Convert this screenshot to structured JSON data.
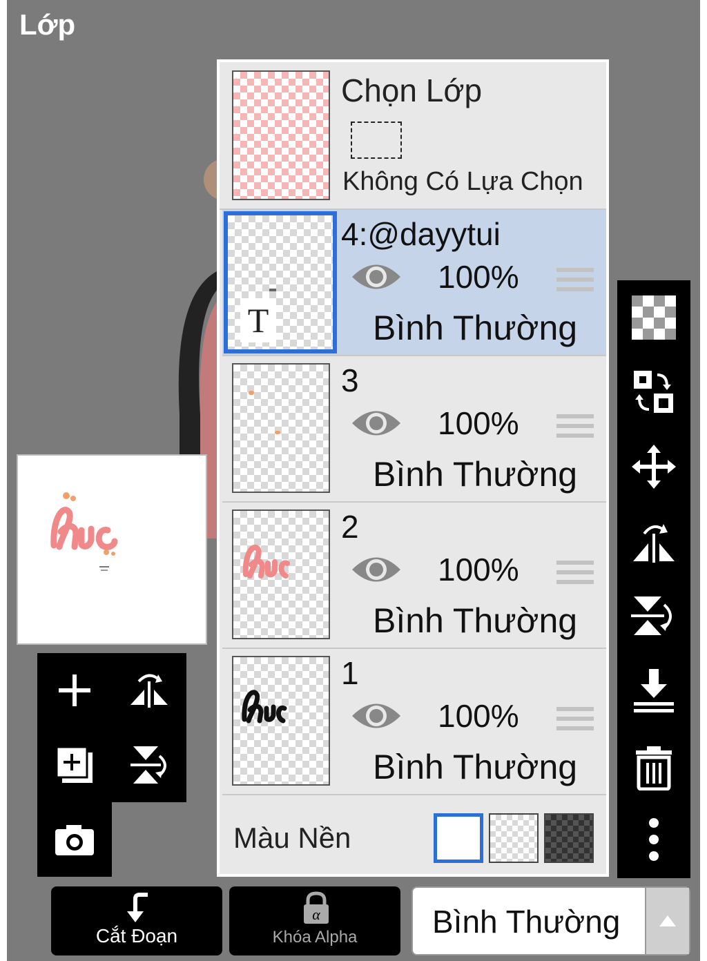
{
  "header": {
    "title": "Lớp"
  },
  "selection": {
    "title": "Chọn Lớp",
    "status": "Không Có Lựa Chọn"
  },
  "layers": [
    {
      "name": "4:@dayytui",
      "opacity": "100%",
      "blend": "Bình Thường",
      "selected": true,
      "type": "text",
      "type_glyph": "T"
    },
    {
      "name": "3",
      "opacity": "100%",
      "blend": "Bình Thường",
      "selected": false
    },
    {
      "name": "2",
      "opacity": "100%",
      "blend": "Bình Thường",
      "selected": false
    },
    {
      "name": "1",
      "opacity": "100%",
      "blend": "Bình Thường",
      "selected": false
    }
  ],
  "background": {
    "label": "Màu Nền",
    "options": [
      "white",
      "transparent",
      "dark"
    ],
    "selected": "white"
  },
  "bottom": {
    "clip_label": "Cắt Đoạn",
    "alpha_lock_label": "Khóa Alpha",
    "blend_mode": "Bình Thường"
  },
  "colors": {
    "accent": "#2c6fd8",
    "selected_row": "#c6d4ea",
    "panel": "#e8e8e8",
    "backdrop": "#7b7b7b"
  },
  "icons": {
    "left_tools": [
      "add-layer-icon",
      "flip-horizontal-icon",
      "add-copy-layer-icon",
      "flip-vertical-icon",
      "camera-icon"
    ],
    "right_tools": [
      "transparency-icon",
      "swap-layers-icon",
      "move-icon",
      "flip-horizontal-icon",
      "flip-vertical-icon",
      "merge-down-icon",
      "trash-icon",
      "more-icon"
    ]
  }
}
